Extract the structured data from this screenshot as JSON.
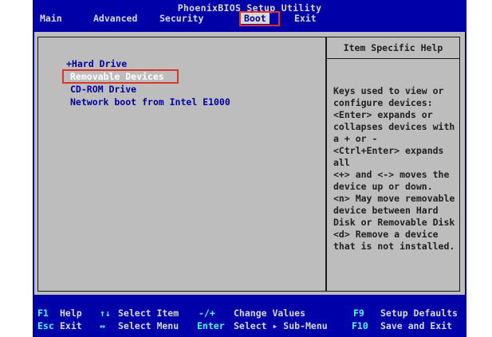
{
  "title": "PhoenixBIOS Setup Utility",
  "menu": [
    "Main",
    "Advanced",
    "Security",
    "Boot",
    "Exit"
  ],
  "boot_items": [
    "+Hard Drive",
    "Removable Devices",
    "CD-ROM Drive",
    "Network boot from Intel E1000"
  ],
  "help_title": "Item Specific Help",
  "help_lines": [
    "Keys used to view or",
    "configure devices:",
    "<Enter> expands or",
    "collapses devices with",
    "a + or -",
    "<Ctrl+Enter> expands",
    "all",
    "<+> and <-> moves the",
    "device up or down.",
    "<n> May move removable",
    "device between Hard",
    "Disk or Removable Disk",
    "<d> Remove a device",
    "that is not installed."
  ],
  "footer": {
    "row1": [
      {
        "key": "F1",
        "label": "Help"
      },
      {
        "key": "↑↓",
        "label": "Select Item"
      },
      {
        "key": "-/+",
        "label": "Change Values"
      },
      {
        "key": "F9",
        "label": "Setup Defaults"
      }
    ],
    "row2": [
      {
        "key": "Esc",
        "label": "Exit"
      },
      {
        "key": "↔",
        "label": "Select Menu"
      },
      {
        "key": "Enter",
        "label": "Select ▸ Sub-Menu"
      },
      {
        "key": "F10",
        "label": "Save and Exit"
      }
    ]
  },
  "colors": {
    "background": "#0000a8",
    "panel": "#bdbdbd",
    "highlight": "#e0342b",
    "key": "#52f7f7"
  }
}
